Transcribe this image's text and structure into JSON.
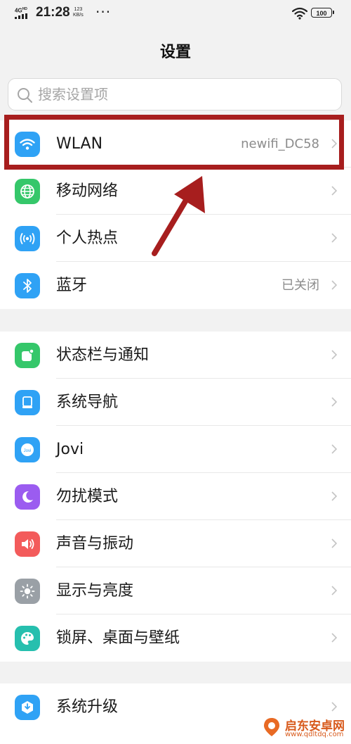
{
  "status_bar": {
    "network": "4G",
    "network_sup": "HD",
    "time": "21:28",
    "speed_value": "123",
    "speed_unit": "KB/s",
    "more": "···",
    "battery": "100"
  },
  "page": {
    "title": "设置"
  },
  "search": {
    "placeholder": "搜索设置项"
  },
  "groups": [
    {
      "items": [
        {
          "label": "WLAN",
          "value": "newifi_DC58",
          "icon": "wifi-icon",
          "color": "#2fa2f5"
        },
        {
          "label": "移动网络",
          "value": "",
          "icon": "globe-icon",
          "color": "#35c76a"
        },
        {
          "label": "个人热点",
          "value": "",
          "icon": "hotspot-icon",
          "color": "#2fa2f5"
        },
        {
          "label": "蓝牙",
          "value": "已关闭",
          "icon": "bluetooth-icon",
          "color": "#2fa2f5"
        }
      ]
    },
    {
      "items": [
        {
          "label": "状态栏与通知",
          "value": "",
          "icon": "notification-icon",
          "color": "#35c76a"
        },
        {
          "label": "系统导航",
          "value": "",
          "icon": "navigation-icon",
          "color": "#2fa2f5"
        },
        {
          "label": "Jovi",
          "value": "",
          "icon": "jovi-icon",
          "color": "#2fa2f5"
        },
        {
          "label": "勿扰模式",
          "value": "",
          "icon": "moon-icon",
          "color": "#9b5cf0"
        },
        {
          "label": "声音与振动",
          "value": "",
          "icon": "speaker-icon",
          "color": "#f35b5b"
        },
        {
          "label": "显示与亮度",
          "value": "",
          "icon": "brightness-icon",
          "color": "#9aa0a6"
        },
        {
          "label": "锁屏、桌面与壁纸",
          "value": "",
          "icon": "palette-icon",
          "color": "#26bfae"
        }
      ]
    },
    {
      "items": [
        {
          "label": "系统升级",
          "value": "",
          "icon": "system-update-icon",
          "color": "#2fa2f5"
        }
      ]
    }
  ],
  "watermark": {
    "title": "启东安卓网",
    "url": "www.qdltdq.com"
  }
}
